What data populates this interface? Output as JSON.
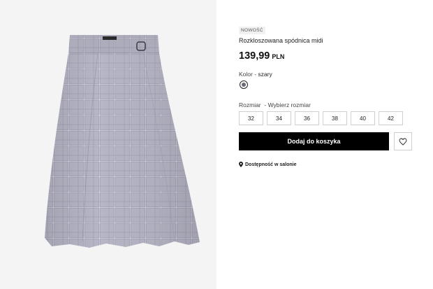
{
  "product": {
    "badge": "NOWOŚĆ",
    "name": "Rozkloszowana spódnica midi",
    "price": "139,99",
    "currency": "PLN",
    "image_icon": "skirt-image"
  },
  "color": {
    "label": "Kolor",
    "separator": " - ",
    "value": "szary",
    "swatch_color": "#6b6b78"
  },
  "size": {
    "label": "Rozmiar",
    "separator": "  - ",
    "prompt": "Wybierz rozmiar",
    "options": [
      "32",
      "34",
      "36",
      "38",
      "40",
      "42"
    ]
  },
  "actions": {
    "add_to_cart": "Dodaj do koszyka",
    "wishlist_icon": "heart-icon"
  },
  "store": {
    "icon": "location-pin-icon",
    "text": "Dostępność w salonie"
  },
  "colors": {
    "button_bg": "#000000",
    "gallery_bg": "#f4f4f4",
    "fabric": "#b9b8c6"
  }
}
